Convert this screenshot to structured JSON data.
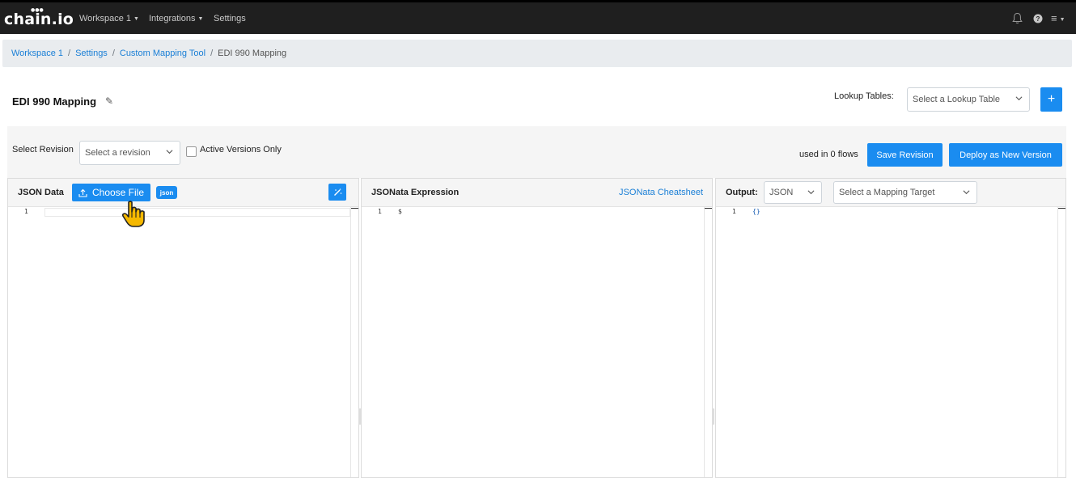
{
  "navbar": {
    "logo": "chain.io",
    "logo_dots": "●●●",
    "workspace": "Workspace 1",
    "integrations": "Integrations",
    "settings": "Settings",
    "bell": "🔔",
    "help": "?",
    "menu": "≡"
  },
  "breadcrumb": {
    "items": [
      "Workspace 1",
      "Settings",
      "Custom Mapping Tool"
    ],
    "separator": "/",
    "current": "EDI 990 Mapping"
  },
  "page": {
    "title": "EDI 990 Mapping",
    "edit_icon": "✎"
  },
  "lookup": {
    "label": "Lookup Tables:",
    "placeholder": "Select a Lookup Table",
    "add_label": "+"
  },
  "revision": {
    "label": "Select Revision",
    "placeholder": "Select a revision",
    "active_only_label": "Active Versions Only",
    "used_in": "used in 0 flows",
    "save_label": "Save Revision",
    "deploy_label": "Deploy as New Version"
  },
  "json_panel": {
    "title": "JSON Data",
    "choose_file_label": "Choose File",
    "format_badge": "json",
    "line_number": "1",
    "code": ""
  },
  "expr_panel": {
    "title": "JSONata Expression",
    "cheatsheet_label": "JSONata Cheatsheet",
    "line_number": "1",
    "code": "$"
  },
  "output_panel": {
    "title": "Output:",
    "format_value": "JSON",
    "target_placeholder": "Select a Mapping Target",
    "line_number": "1",
    "code": "{}"
  },
  "colors": {
    "navbar_bg": "#1f1f1f",
    "accent_blue": "#1a8cf0",
    "link_blue": "#1a7fd6",
    "cursor_yellow": "#f5b800"
  }
}
